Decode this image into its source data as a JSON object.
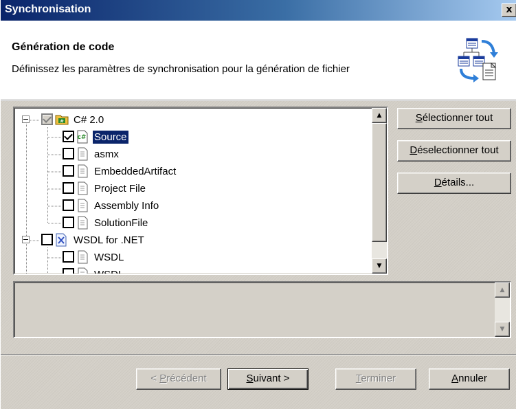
{
  "window": {
    "title": "Synchronisation",
    "close_label": "x"
  },
  "header": {
    "title": "Génération de code",
    "subtitle": "Définissez les paramètres de synchronisation pour la génération de fichier",
    "icon": "sync-diagram-icon"
  },
  "tree": {
    "items": [
      {
        "label": "C# 2.0",
        "level": 0,
        "checked": true,
        "grey": true,
        "icon": "csharp-project-icon"
      },
      {
        "label": "Source",
        "level": 1,
        "checked": true,
        "selected": true,
        "icon": "csharp-file-icon"
      },
      {
        "label": "asmx",
        "level": 1,
        "checked": false,
        "icon": "document-icon"
      },
      {
        "label": "EmbeddedArtifact",
        "level": 1,
        "checked": false,
        "icon": "document-icon"
      },
      {
        "label": "Project File",
        "level": 1,
        "checked": false,
        "icon": "document-icon"
      },
      {
        "label": "Assembly Info",
        "level": 1,
        "checked": false,
        "icon": "document-icon"
      },
      {
        "label": "SolutionFile",
        "level": 1,
        "checked": false,
        "icon": "document-icon"
      },
      {
        "label": "WSDL for .NET",
        "level": 0,
        "checked": false,
        "icon": "wsdl-project-icon"
      },
      {
        "label": "WSDL",
        "level": 1,
        "checked": false,
        "icon": "document-icon"
      },
      {
        "label": "WSDL",
        "level": 1,
        "checked": false,
        "icon": "document-icon"
      }
    ]
  },
  "side_buttons": {
    "select_all": {
      "accel": "S",
      "rest": "électionner tout"
    },
    "deselect_all": {
      "accel": "D",
      "rest": "éselectionner tout"
    },
    "details": {
      "accel": "D",
      "rest": "étails..."
    }
  },
  "footer": {
    "previous": {
      "prefix": "< ",
      "accel": "P",
      "rest": "récédent"
    },
    "next": {
      "accel": "S",
      "rest": "uivant >"
    },
    "finish": {
      "accel": "T",
      "rest": "erminer"
    },
    "cancel": {
      "accel": "A",
      "rest": "nnuler"
    }
  }
}
